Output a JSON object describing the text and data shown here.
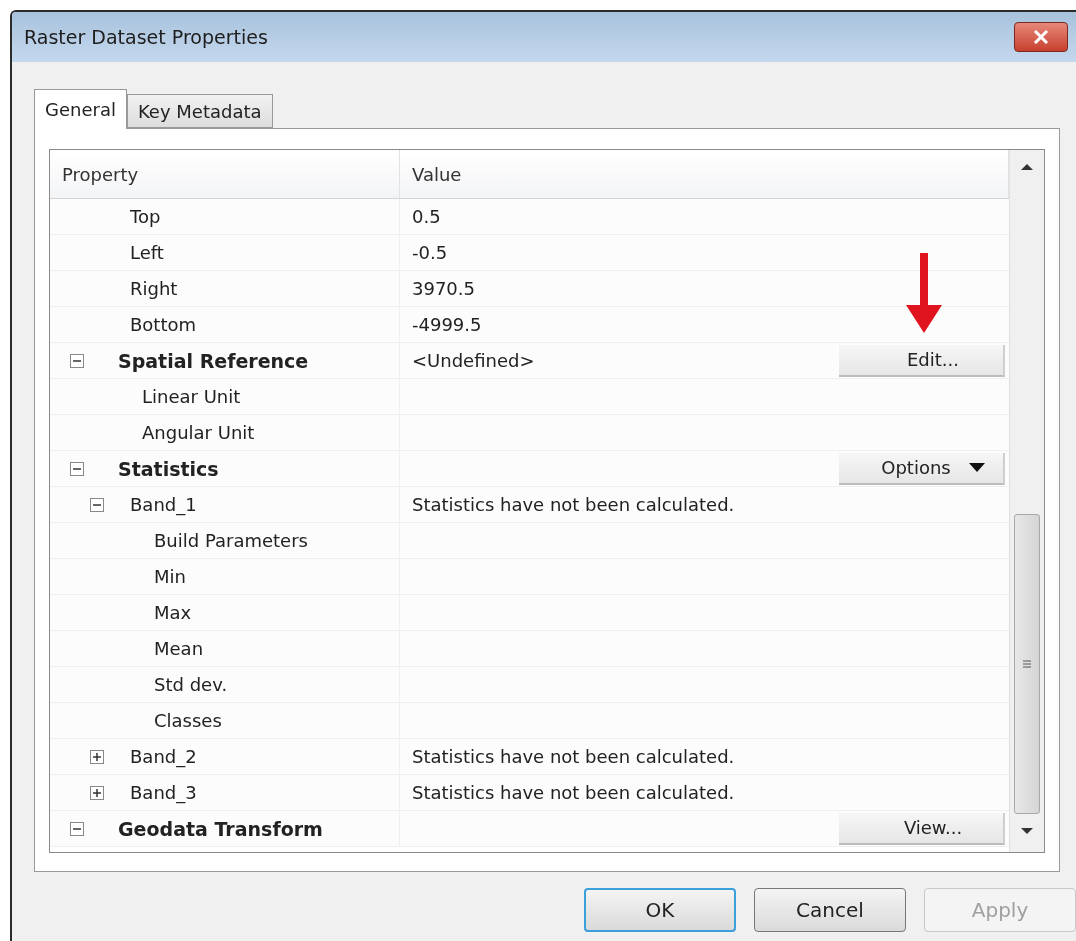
{
  "window": {
    "title": "Raster Dataset Properties"
  },
  "tabs": [
    {
      "label": "General",
      "selected": true
    },
    {
      "label": "Key Metadata",
      "selected": false
    }
  ],
  "grid": {
    "columns": [
      "Property",
      "Value"
    ],
    "rows": [
      {
        "label": "Top",
        "value": "0.5"
      },
      {
        "label": "Left",
        "value": "-0.5"
      },
      {
        "label": "Right",
        "value": "3970.5"
      },
      {
        "label": "Bottom",
        "value": "-4999.5"
      },
      {
        "label": "Spatial Reference",
        "value": "<Undefined>",
        "expanded": true,
        "button": {
          "label": "Edit...",
          "dropdown": false
        },
        "children": [
          {
            "label": "Linear Unit"
          },
          {
            "label": "Angular Unit"
          }
        ]
      },
      {
        "label": "Statistics",
        "expanded": true,
        "button": {
          "label": "Options",
          "dropdown": true
        },
        "children": [
          {
            "label": "Band_1",
            "value": "Statistics have not been calculated.",
            "expanded": true,
            "children": [
              {
                "label": "Build Parameters"
              },
              {
                "label": "Min"
              },
              {
                "label": "Max"
              },
              {
                "label": "Mean"
              },
              {
                "label": "Std dev."
              },
              {
                "label": "Classes"
              }
            ]
          },
          {
            "label": "Band_2",
            "value": "Statistics have not been calculated.",
            "expanded": false
          },
          {
            "label": "Band_3",
            "value": "Statistics have not been calculated.",
            "expanded": false
          }
        ]
      },
      {
        "label": "Geodata Transform",
        "expanded": true,
        "button": {
          "label": "View...",
          "dropdown": false
        }
      }
    ]
  },
  "buttons": [
    {
      "label": "OK",
      "default": true,
      "disabled": false
    },
    {
      "label": "Cancel",
      "default": false,
      "disabled": false
    },
    {
      "label": "Apply",
      "default": false,
      "disabled": true
    }
  ]
}
